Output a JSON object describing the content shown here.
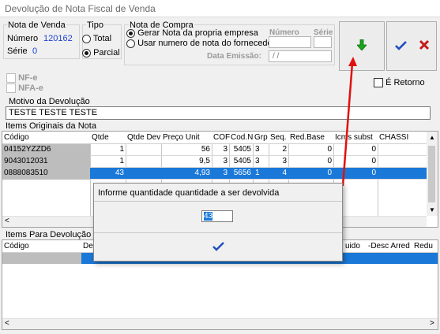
{
  "window": {
    "title": "Devolução de Nota Fiscal de Venda"
  },
  "nota_venda": {
    "group_label": "Nota de Venda",
    "numero_label": "Número",
    "numero_value": "120162",
    "serie_label": "Série",
    "serie_value": "0"
  },
  "tipo": {
    "group_label": "Tipo",
    "options": [
      "Total",
      "Parcial"
    ],
    "selected": "Parcial"
  },
  "nota_compra": {
    "group_label": "Nota de Compra",
    "option_gerar": "Gerar Nota da propria empresa",
    "option_fornecedor": "Usar numero de nota do fornecedor==>",
    "numero_label": "Número",
    "serie_label": "Série",
    "data_label": "Data Emissão:",
    "data_value": " / /"
  },
  "toolbar": {
    "download_icon": "green-down-arrow",
    "confirm_icon": "check-icon",
    "cancel_icon": "x-icon"
  },
  "checks": {
    "nfe": "NF-e",
    "nfae": "NFA-e",
    "retorno": "É Retorno"
  },
  "motivo": {
    "label": "Motivo da Devolução",
    "value": "TESTE TESTE TESTE"
  },
  "itens_originais": {
    "label": "Items Originais da Nota",
    "columns": [
      "Código",
      "Qtde",
      "Qtde Dev",
      "Preço Unit",
      "COF",
      "Cod.N",
      "Grp",
      "Seq.",
      "Red.Base",
      "Icms subst",
      "CHASSI"
    ],
    "rows": [
      {
        "codigo": "04152YZZD6",
        "qtde": "1",
        "qtde_dev": "",
        "preco": "56",
        "cof": "3",
        "codn": "5405",
        "grp": "3",
        "seq": "2",
        "redbase": "0",
        "icms": "0"
      },
      {
        "codigo": "9043012031",
        "qtde": "1",
        "qtde_dev": "",
        "preco": "9,5",
        "cof": "3",
        "codn": "5405",
        "grp": "3",
        "seq": "3",
        "redbase": "0",
        "icms": "0"
      },
      {
        "codigo": "0888083510",
        "qtde": "43",
        "qtde_dev": "",
        "preco": "4,93",
        "cof": "3",
        "codn": "5656",
        "grp": "1",
        "seq": "4",
        "redbase": "0",
        "icms": "0"
      }
    ]
  },
  "itens_devolucao": {
    "label": "Items Para Devolução",
    "columns": [
      "Código",
      "Desc",
      "uido",
      "-Desc Arred",
      "Redu"
    ]
  },
  "dialog": {
    "prompt": "Informe quantidade quantidade a  ser devolvida",
    "value": "43",
    "ok_icon": "check-icon"
  }
}
